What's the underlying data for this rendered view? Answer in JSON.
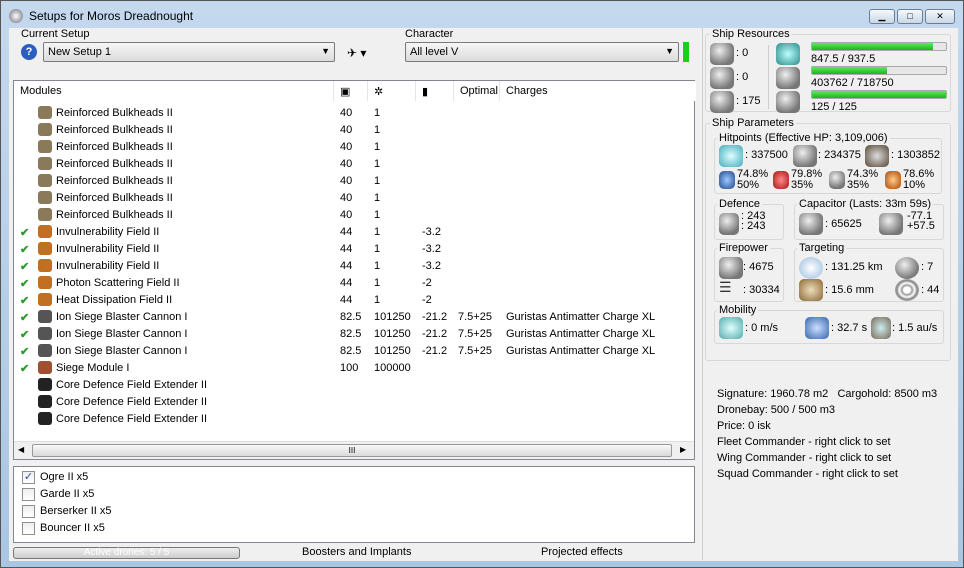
{
  "window": {
    "title": "Setups for Moros Dreadnought",
    "min": "▁",
    "max": "□",
    "close": "✕"
  },
  "setup": {
    "label": "Current Setup",
    "value": "New Setup 1"
  },
  "character": {
    "label": "Character",
    "value": "All level V"
  },
  "modules": {
    "headers": [
      "Modules",
      "cpu-icon",
      "power-icon",
      "cap-icon",
      "Optimal",
      "Charges"
    ],
    "rows": [
      {
        "check": "",
        "name": "Reinforced Bulkheads II",
        "cpu": "40",
        "pg": "1",
        "cap": "",
        "opt": "",
        "charge": "",
        "icon": "#8a7a5a"
      },
      {
        "check": "",
        "name": "Reinforced Bulkheads II",
        "cpu": "40",
        "pg": "1",
        "cap": "",
        "opt": "",
        "charge": "",
        "icon": "#8a7a5a"
      },
      {
        "check": "",
        "name": "Reinforced Bulkheads II",
        "cpu": "40",
        "pg": "1",
        "cap": "",
        "opt": "",
        "charge": "",
        "icon": "#8a7a5a"
      },
      {
        "check": "",
        "name": "Reinforced Bulkheads II",
        "cpu": "40",
        "pg": "1",
        "cap": "",
        "opt": "",
        "charge": "",
        "icon": "#8a7a5a"
      },
      {
        "check": "",
        "name": "Reinforced Bulkheads II",
        "cpu": "40",
        "pg": "1",
        "cap": "",
        "opt": "",
        "charge": "",
        "icon": "#8a7a5a"
      },
      {
        "check": "",
        "name": "Reinforced Bulkheads II",
        "cpu": "40",
        "pg": "1",
        "cap": "",
        "opt": "",
        "charge": "",
        "icon": "#8a7a5a"
      },
      {
        "check": "",
        "name": "Reinforced Bulkheads II",
        "cpu": "40",
        "pg": "1",
        "cap": "",
        "opt": "",
        "charge": "",
        "icon": "#8a7a5a"
      },
      {
        "check": "✔",
        "name": "Invulnerability Field II",
        "cpu": "44",
        "pg": "1",
        "cap": "-3.2",
        "opt": "",
        "charge": "",
        "icon": "#c07020"
      },
      {
        "check": "✔",
        "name": "Invulnerability Field II",
        "cpu": "44",
        "pg": "1",
        "cap": "-3.2",
        "opt": "",
        "charge": "",
        "icon": "#c07020"
      },
      {
        "check": "✔",
        "name": "Invulnerability Field II",
        "cpu": "44",
        "pg": "1",
        "cap": "-3.2",
        "opt": "",
        "charge": "",
        "icon": "#c07020"
      },
      {
        "check": "✔",
        "name": "Photon Scattering Field II",
        "cpu": "44",
        "pg": "1",
        "cap": "-2",
        "opt": "",
        "charge": "",
        "icon": "#c07020"
      },
      {
        "check": "✔",
        "name": "Heat Dissipation Field II",
        "cpu": "44",
        "pg": "1",
        "cap": "-2",
        "opt": "",
        "charge": "",
        "icon": "#c07020"
      },
      {
        "check": "✔",
        "name": "Ion Siege Blaster Cannon I",
        "cpu": "82.5",
        "pg": "101250",
        "cap": "-21.2",
        "opt": "7.5+25",
        "charge": "Guristas Antimatter Charge XL",
        "icon": "#555"
      },
      {
        "check": "✔",
        "name": "Ion Siege Blaster Cannon I",
        "cpu": "82.5",
        "pg": "101250",
        "cap": "-21.2",
        "opt": "7.5+25",
        "charge": "Guristas Antimatter Charge XL",
        "icon": "#555"
      },
      {
        "check": "✔",
        "name": "Ion Siege Blaster Cannon I",
        "cpu": "82.5",
        "pg": "101250",
        "cap": "-21.2",
        "opt": "7.5+25",
        "charge": "Guristas Antimatter Charge XL",
        "icon": "#555"
      },
      {
        "check": "✔",
        "name": "Siege Module I",
        "cpu": "100",
        "pg": "100000",
        "cap": "",
        "opt": "",
        "charge": "",
        "icon": "#a05030"
      },
      {
        "check": "",
        "name": "Core Defence Field Extender II",
        "cpu": "",
        "pg": "",
        "cap": "",
        "opt": "",
        "charge": "",
        "icon": "#222"
      },
      {
        "check": "",
        "name": "Core Defence Field Extender II",
        "cpu": "",
        "pg": "",
        "cap": "",
        "opt": "",
        "charge": "",
        "icon": "#222"
      },
      {
        "check": "",
        "name": "Core Defence Field Extender II",
        "cpu": "",
        "pg": "",
        "cap": "",
        "opt": "",
        "charge": "",
        "icon": "#222"
      }
    ],
    "scroll_grip": "III"
  },
  "drones": [
    {
      "name": "Ogre II x5",
      "checked": true
    },
    {
      "name": "Garde II x5",
      "checked": false
    },
    {
      "name": "Berserker II x5",
      "checked": false
    },
    {
      "name": "Bouncer II x5",
      "checked": false
    }
  ],
  "bottom": {
    "active_drones": "Active drones: 5 / 5",
    "boosters": "Boosters and Implants",
    "projected": "Projected effects"
  },
  "resources": {
    "title": "Ship Resources",
    "turrets": ": 0",
    "launchers": ": 0",
    "calibration": ": 175",
    "cpu": {
      "text": "847.5 / 937.5",
      "fraction": 0.904
    },
    "powergrid": {
      "text": "403762 / 718750",
      "fraction": 0.562
    },
    "bandwidth": {
      "text": "125 / 125",
      "fraction": 1.0
    }
  },
  "params": {
    "title": "Ship Parameters",
    "hp": {
      "title": "Hitpoints (Effective HP: 3,109,006)",
      "shield": ": 337500",
      "armor": ": 234375",
      "structure": ": 1303852",
      "resists": [
        {
          "a": "74.8%",
          "b": "50%"
        },
        {
          "a": "79.8%",
          "b": "35%"
        },
        {
          "a": "74.3%",
          "b": "35%"
        },
        {
          "a": "78.6%",
          "b": "10%"
        }
      ]
    },
    "defence": {
      "title": "Defence",
      "a": ": 243",
      "b": ": 243"
    },
    "capacitor": {
      "title": "Capacitor (Lasts: 33m 59s)",
      "amount": ": 65625",
      "use": "-77.1",
      "recharge": "+57.5"
    },
    "firepower": {
      "title": "Firepower",
      "dps": ": 4675",
      "volley": ": 30334"
    },
    "targeting": {
      "title": "Targeting",
      "range": ": 131.25 km",
      "targets": ": 7",
      "sigres": ": 15.6 mm",
      "scanres": ": 44"
    },
    "mobility": {
      "title": "Mobility",
      "speed": ": 0 m/s",
      "align": ": 32.7 s",
      "warp": ": 1.5 au/s"
    }
  },
  "info": [
    "Signature: 1960.78 m2   Cargohold: 8500 m3",
    "Dronebay: 500 / 500 m3",
    "Price: 0 isk",
    "Fleet Commander - right click to set",
    "Wing Commander - right click to set",
    "Squad Commander - right click to set"
  ],
  "colors": {
    "accent_green": "#19b619",
    "check": "#2a9a2a"
  }
}
